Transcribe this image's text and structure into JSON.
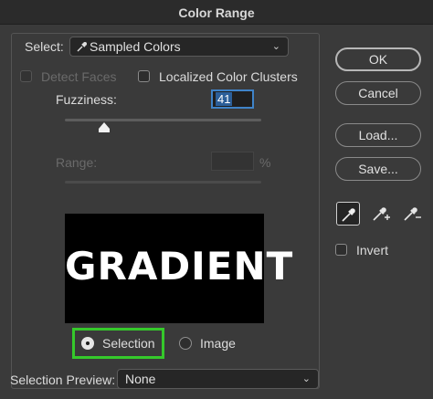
{
  "window": {
    "title": "Color Range"
  },
  "select_row": {
    "label": "Select:",
    "value": "Sampled Colors",
    "icon": "eyedropper-icon"
  },
  "options": {
    "detect_faces": "Detect Faces",
    "localized_clusters": "Localized Color Clusters"
  },
  "fuzziness": {
    "label": "Fuzziness:",
    "value": "41",
    "slider_fraction": 0.2
  },
  "range": {
    "label": "Range:",
    "unit": "%"
  },
  "preview": {
    "text": "GRADIENT"
  },
  "preview_mode": {
    "selection": "Selection",
    "image": "Image",
    "selected": "selection"
  },
  "selection_preview": {
    "label": "Selection Preview:",
    "value": "None"
  },
  "buttons": {
    "ok": "OK",
    "cancel": "Cancel",
    "load": "Load...",
    "save": "Save..."
  },
  "tools": [
    "eyedropper-icon",
    "eyedropper-plus-icon",
    "eyedropper-minus-icon"
  ],
  "invert": {
    "label": "Invert"
  },
  "colors": {
    "accent": "#3f83c8",
    "highlight": "#35c92b",
    "background": "#3a3a3a"
  }
}
